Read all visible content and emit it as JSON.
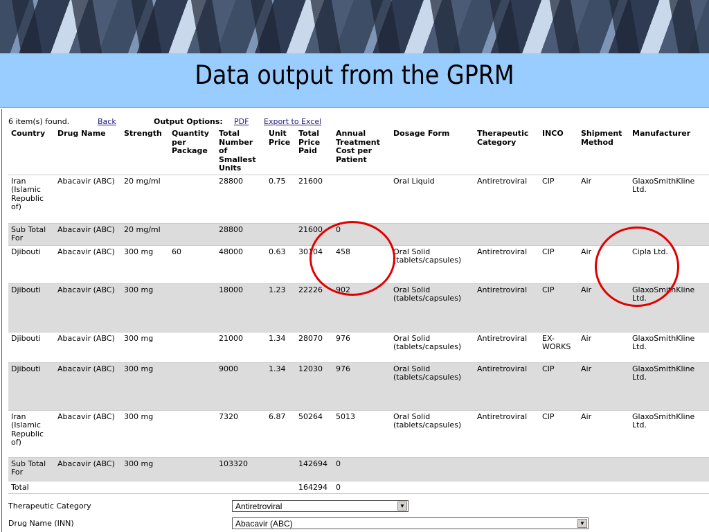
{
  "slide_title": "Data output from the GPRM",
  "toolbar": {
    "count": "6 item(s) found.",
    "back": "Back",
    "output_label": "Output Options:",
    "pdf": "PDF",
    "excel": "Export to Excel"
  },
  "columns": [
    "Country",
    "Drug Name",
    "Strength",
    "Quantity per Package",
    "Total Number of Smallest Units",
    "Unit Price",
    "Total Price Paid",
    "Annual Treatment Cost per Patient",
    "Dosage Form",
    "Therapeutic Category",
    "INCO",
    "Shipment Method",
    "Manufacturer"
  ],
  "rows": [
    {
      "cells": [
        "Iran (Islamic Republic of)",
        "Abacavir (ABC)",
        "20 mg/ml",
        "",
        "28800",
        "0.75",
        "21600",
        "",
        "Oral Liquid",
        "Antiretroviral",
        "CIP",
        "Air",
        "GlaxoSmithKline Ltd."
      ]
    },
    {
      "cells": [
        "Sub Total For",
        "Abacavir (ABC)",
        "20 mg/ml",
        "",
        "28800",
        "",
        "21600",
        "0",
        "",
        "",
        "",
        "",
        ""
      ]
    },
    {
      "cells": [
        "Djibouti",
        "Abacavir (ABC)",
        "300 mg",
        "60",
        "48000",
        "0.63",
        "30104",
        "458",
        "Oral Solid (tablets/capsules)",
        "Antiretroviral",
        "CIP",
        "Air",
        "Cipla Ltd."
      ]
    },
    {
      "cells": [
        "Djibouti",
        "Abacavir (ABC)",
        "300 mg",
        "",
        "18000",
        "1.23",
        "22226",
        "902",
        "Oral Solid (tablets/capsules)",
        "Antiretroviral",
        "CIP",
        "Air",
        "GlaxoSmithKline Ltd."
      ]
    },
    {
      "cells": [
        "Djibouti",
        "Abacavir (ABC)",
        "300 mg",
        "",
        "21000",
        "1.34",
        "28070",
        "976",
        "Oral Solid (tablets/capsules)",
        "Antiretroviral",
        "EX-WORKS",
        "Air",
        "GlaxoSmithKline Ltd."
      ]
    },
    {
      "cells": [
        "Djibouti",
        "Abacavir (ABC)",
        "300 mg",
        "",
        "9000",
        "1.34",
        "12030",
        "976",
        "Oral Solid (tablets/capsules)",
        "Antiretroviral",
        "CIP",
        "Air",
        "GlaxoSmithKline Ltd."
      ]
    },
    {
      "cells": [
        "Iran (Islamic Republic of)",
        "Abacavir (ABC)",
        "300 mg",
        "",
        "7320",
        "6.87",
        "50264",
        "5013",
        "Oral Solid (tablets/capsules)",
        "Antiretroviral",
        "CIP",
        "Air",
        "GlaxoSmithKline Ltd."
      ]
    },
    {
      "cells": [
        "Sub Total For",
        "Abacavir (ABC)",
        "300 mg",
        "",
        "103320",
        "",
        "142694",
        "0",
        "",
        "",
        "",
        "",
        ""
      ]
    },
    {
      "cells": [
        "Total",
        "",
        "",
        "",
        "",
        "",
        "164294",
        "0",
        "",
        "",
        "",
        "",
        ""
      ]
    }
  ],
  "form": {
    "therapeutic_label": "Therapeutic Category",
    "therapeutic_value": "Antiretroviral",
    "drug_label": "Drug Name (INN)",
    "drug_value": "Abacavir (ABC)"
  },
  "colors": {
    "title_band": "#99ccff",
    "highlight": "#e00000",
    "subtotal_row": "#dcdcdc"
  }
}
